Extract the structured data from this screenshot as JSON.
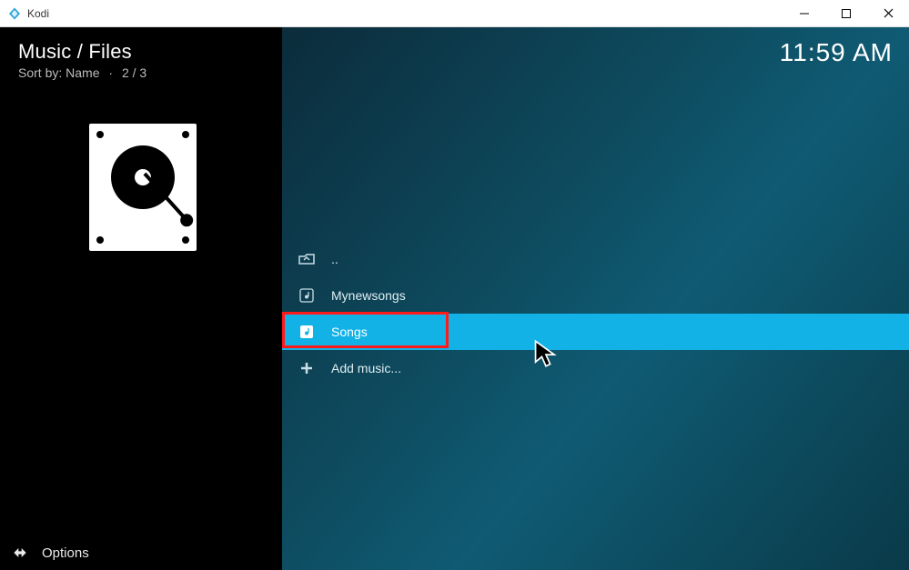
{
  "window": {
    "title": "Kodi"
  },
  "header": {
    "breadcrumb": "Music / Files",
    "sort_label": "Sort by:",
    "sort_value": "Name",
    "page": "2 / 3",
    "clock": "11:59 AM"
  },
  "list": {
    "back_label": "..",
    "items": [
      {
        "label": "Mynewsongs"
      },
      {
        "label": "Songs"
      },
      {
        "label": "Add music..."
      }
    ],
    "selected_index": 1
  },
  "footer": {
    "options_label": "Options"
  }
}
